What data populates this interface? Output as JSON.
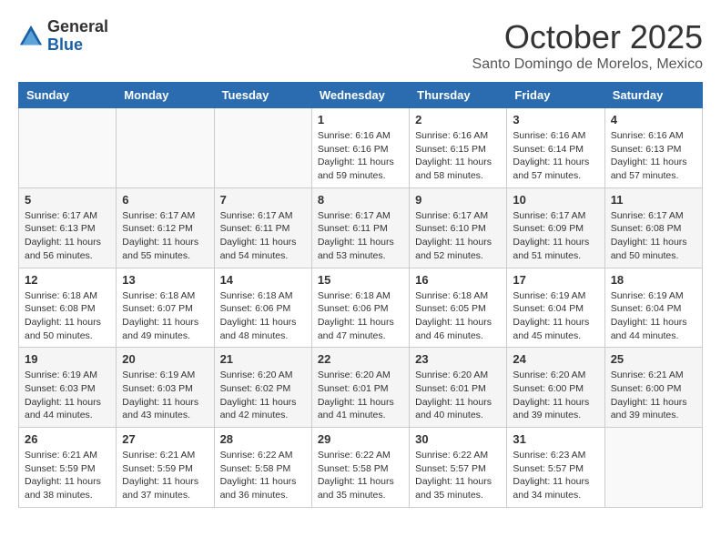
{
  "logo": {
    "general": "General",
    "blue": "Blue"
  },
  "title": "October 2025",
  "location": "Santo Domingo de Morelos, Mexico",
  "weekdays": [
    "Sunday",
    "Monday",
    "Tuesday",
    "Wednesday",
    "Thursday",
    "Friday",
    "Saturday"
  ],
  "weeks": [
    [
      {
        "day": "",
        "info": ""
      },
      {
        "day": "",
        "info": ""
      },
      {
        "day": "",
        "info": ""
      },
      {
        "day": "1",
        "info": "Sunrise: 6:16 AM\nSunset: 6:16 PM\nDaylight: 11 hours\nand 59 minutes."
      },
      {
        "day": "2",
        "info": "Sunrise: 6:16 AM\nSunset: 6:15 PM\nDaylight: 11 hours\nand 58 minutes."
      },
      {
        "day": "3",
        "info": "Sunrise: 6:16 AM\nSunset: 6:14 PM\nDaylight: 11 hours\nand 57 minutes."
      },
      {
        "day": "4",
        "info": "Sunrise: 6:16 AM\nSunset: 6:13 PM\nDaylight: 11 hours\nand 57 minutes."
      }
    ],
    [
      {
        "day": "5",
        "info": "Sunrise: 6:17 AM\nSunset: 6:13 PM\nDaylight: 11 hours\nand 56 minutes."
      },
      {
        "day": "6",
        "info": "Sunrise: 6:17 AM\nSunset: 6:12 PM\nDaylight: 11 hours\nand 55 minutes."
      },
      {
        "day": "7",
        "info": "Sunrise: 6:17 AM\nSunset: 6:11 PM\nDaylight: 11 hours\nand 54 minutes."
      },
      {
        "day": "8",
        "info": "Sunrise: 6:17 AM\nSunset: 6:11 PM\nDaylight: 11 hours\nand 53 minutes."
      },
      {
        "day": "9",
        "info": "Sunrise: 6:17 AM\nSunset: 6:10 PM\nDaylight: 11 hours\nand 52 minutes."
      },
      {
        "day": "10",
        "info": "Sunrise: 6:17 AM\nSunset: 6:09 PM\nDaylight: 11 hours\nand 51 minutes."
      },
      {
        "day": "11",
        "info": "Sunrise: 6:17 AM\nSunset: 6:08 PM\nDaylight: 11 hours\nand 50 minutes."
      }
    ],
    [
      {
        "day": "12",
        "info": "Sunrise: 6:18 AM\nSunset: 6:08 PM\nDaylight: 11 hours\nand 50 minutes."
      },
      {
        "day": "13",
        "info": "Sunrise: 6:18 AM\nSunset: 6:07 PM\nDaylight: 11 hours\nand 49 minutes."
      },
      {
        "day": "14",
        "info": "Sunrise: 6:18 AM\nSunset: 6:06 PM\nDaylight: 11 hours\nand 48 minutes."
      },
      {
        "day": "15",
        "info": "Sunrise: 6:18 AM\nSunset: 6:06 PM\nDaylight: 11 hours\nand 47 minutes."
      },
      {
        "day": "16",
        "info": "Sunrise: 6:18 AM\nSunset: 6:05 PM\nDaylight: 11 hours\nand 46 minutes."
      },
      {
        "day": "17",
        "info": "Sunrise: 6:19 AM\nSunset: 6:04 PM\nDaylight: 11 hours\nand 45 minutes."
      },
      {
        "day": "18",
        "info": "Sunrise: 6:19 AM\nSunset: 6:04 PM\nDaylight: 11 hours\nand 44 minutes."
      }
    ],
    [
      {
        "day": "19",
        "info": "Sunrise: 6:19 AM\nSunset: 6:03 PM\nDaylight: 11 hours\nand 44 minutes."
      },
      {
        "day": "20",
        "info": "Sunrise: 6:19 AM\nSunset: 6:03 PM\nDaylight: 11 hours\nand 43 minutes."
      },
      {
        "day": "21",
        "info": "Sunrise: 6:20 AM\nSunset: 6:02 PM\nDaylight: 11 hours\nand 42 minutes."
      },
      {
        "day": "22",
        "info": "Sunrise: 6:20 AM\nSunset: 6:01 PM\nDaylight: 11 hours\nand 41 minutes."
      },
      {
        "day": "23",
        "info": "Sunrise: 6:20 AM\nSunset: 6:01 PM\nDaylight: 11 hours\nand 40 minutes."
      },
      {
        "day": "24",
        "info": "Sunrise: 6:20 AM\nSunset: 6:00 PM\nDaylight: 11 hours\nand 39 minutes."
      },
      {
        "day": "25",
        "info": "Sunrise: 6:21 AM\nSunset: 6:00 PM\nDaylight: 11 hours\nand 39 minutes."
      }
    ],
    [
      {
        "day": "26",
        "info": "Sunrise: 6:21 AM\nSunset: 5:59 PM\nDaylight: 11 hours\nand 38 minutes."
      },
      {
        "day": "27",
        "info": "Sunrise: 6:21 AM\nSunset: 5:59 PM\nDaylight: 11 hours\nand 37 minutes."
      },
      {
        "day": "28",
        "info": "Sunrise: 6:22 AM\nSunset: 5:58 PM\nDaylight: 11 hours\nand 36 minutes."
      },
      {
        "day": "29",
        "info": "Sunrise: 6:22 AM\nSunset: 5:58 PM\nDaylight: 11 hours\nand 35 minutes."
      },
      {
        "day": "30",
        "info": "Sunrise: 6:22 AM\nSunset: 5:57 PM\nDaylight: 11 hours\nand 35 minutes."
      },
      {
        "day": "31",
        "info": "Sunrise: 6:23 AM\nSunset: 5:57 PM\nDaylight: 11 hours\nand 34 minutes."
      },
      {
        "day": "",
        "info": ""
      }
    ]
  ]
}
